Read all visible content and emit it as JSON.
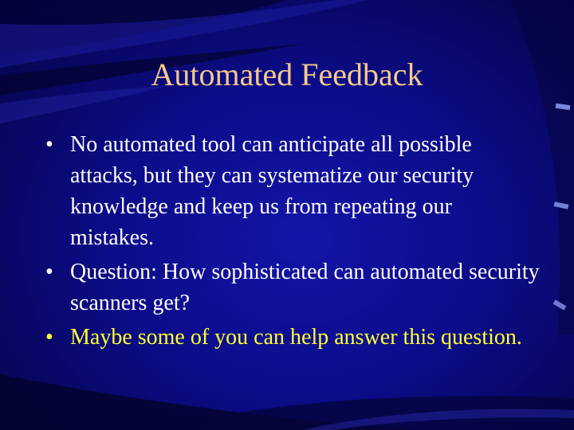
{
  "slide": {
    "title": "Automated Feedback",
    "bullets": [
      {
        "marker": "•",
        "text": "No automated tool can anticipate all possible attacks, but they can systematize our security knowledge and keep us from repeating our mistakes."
      },
      {
        "marker": "•",
        "text": "Question: How sophisticated can automated security scanners get?"
      },
      {
        "marker": "•",
        "text": "Maybe some of you can help answer this question."
      }
    ]
  },
  "colors": {
    "background": "#0a0a78",
    "title": "#f5c98a",
    "body_text": "#ffffff",
    "highlight_text": "#ffff33"
  }
}
